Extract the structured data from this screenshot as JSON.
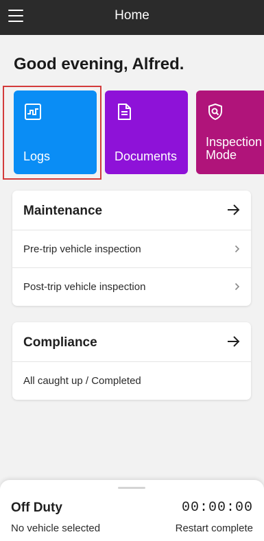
{
  "header": {
    "title": "Home",
    "menu_icon": "hamburger-icon"
  },
  "greeting": "Good evening, Alfred.",
  "tiles": [
    {
      "label": "Logs",
      "icon": "logs-icon",
      "color": "#0a8df5"
    },
    {
      "label": "Documents",
      "icon": "document-icon",
      "color": "#8e12d8"
    },
    {
      "label": "Inspection Mode",
      "label_line1": "Inspection",
      "label_line2": "Mode",
      "icon": "shield-search-icon",
      "color": "#b0147a"
    }
  ],
  "maintenance": {
    "title": "Maintenance",
    "items": [
      {
        "label": "Pre-trip vehicle inspection"
      },
      {
        "label": "Post-trip vehicle inspection"
      }
    ]
  },
  "compliance": {
    "title": "Compliance",
    "status": "All caught up / Completed"
  },
  "status_bar": {
    "duty_status": "Off Duty",
    "timer": "00:00:00",
    "vehicle": "No vehicle selected",
    "restart": "Restart complete"
  },
  "colors": {
    "topbar": "#2b2b2b",
    "highlight": "#d33a3a"
  }
}
